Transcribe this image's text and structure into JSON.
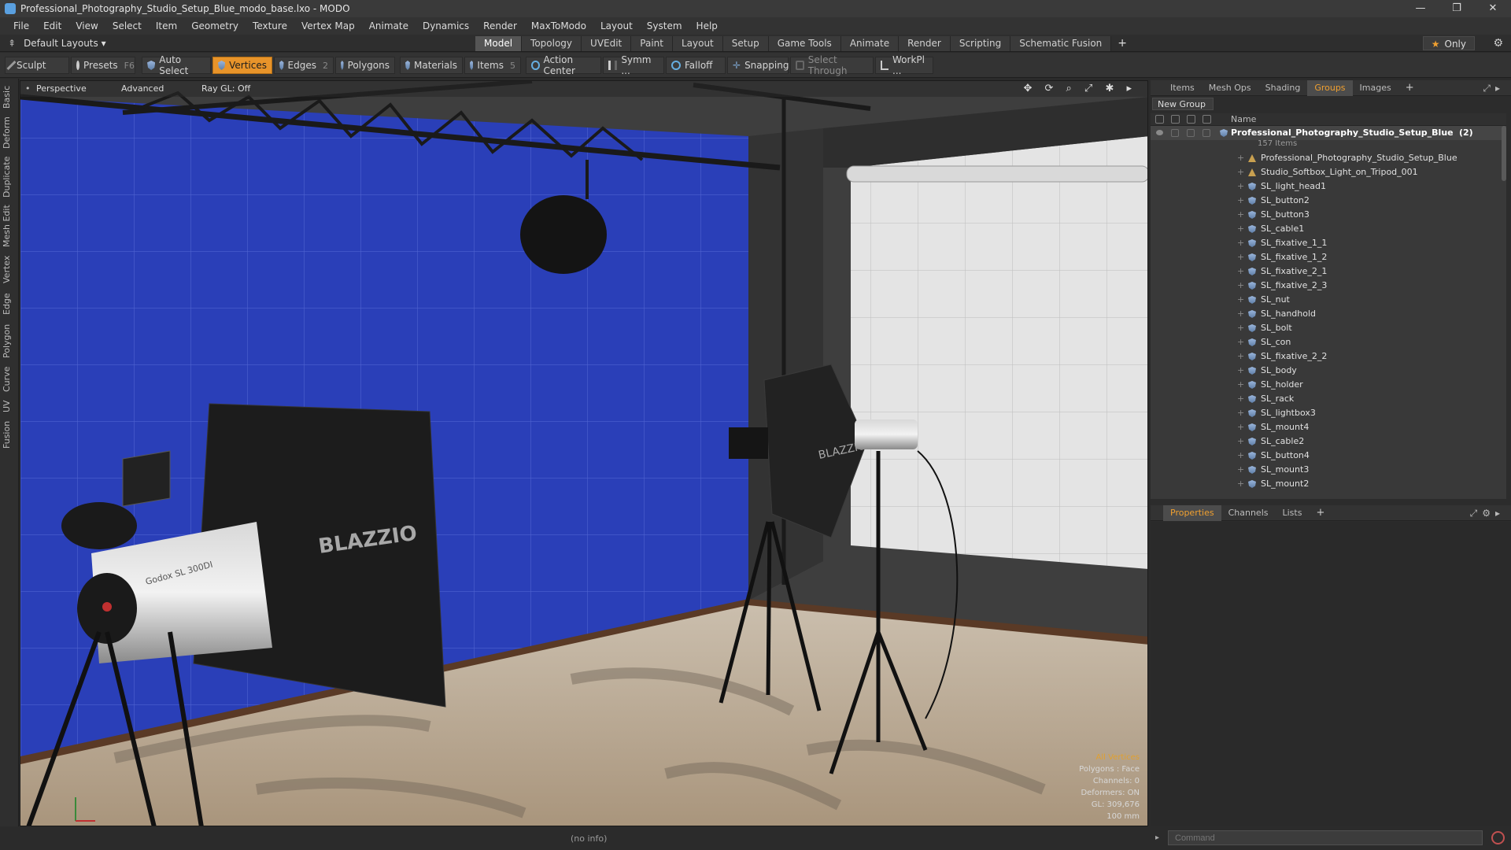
{
  "window": {
    "title": "Professional_Photography_Studio_Setup_Blue_modo_base.lxo - MODO",
    "controls": [
      "—",
      "❐",
      "✕"
    ]
  },
  "menu": [
    "File",
    "Edit",
    "View",
    "Select",
    "Item",
    "Geometry",
    "Texture",
    "Vertex Map",
    "Animate",
    "Dynamics",
    "Render",
    "MaxToModo",
    "Layout",
    "System",
    "Help"
  ],
  "layoutbar": {
    "layout_dropdown": "Default Layouts ▾",
    "tabs": [
      "Model",
      "Topology",
      "UVEdit",
      "Paint",
      "Layout",
      "Setup",
      "Game Tools",
      "Animate",
      "Render",
      "Scripting",
      "Schematic Fusion"
    ],
    "active_tab": "Model",
    "add_tab": "+",
    "only_label": "Only"
  },
  "toolbar": {
    "sculpt": "Sculpt",
    "presets": "Presets",
    "presets_key": "F6",
    "auto_select": "Auto Select",
    "vertices": "Vertices",
    "edges": "Edges",
    "edges_count": "2",
    "polygons": "Polygons",
    "materials": "Materials",
    "items": "Items",
    "items_count": "5",
    "action_center": "Action Center",
    "symm": "Symm ...",
    "falloff": "Falloff",
    "snapping": "Snapping",
    "select_through": "Select Through",
    "workpl": "WorkPl ..."
  },
  "left_strip": [
    "Basic",
    "Deform",
    "Duplicate",
    "Mesh Edit",
    "Vertex",
    "Edge",
    "Polygon",
    "Curve",
    "UV",
    "Fusion"
  ],
  "viewport": {
    "view_mode": "Perspective",
    "shading": "Advanced",
    "raygl": "Ray GL: Off",
    "controls": "✥ ⟳ ⌕ ⤢ ✱ ▸",
    "softbox_logo": "BLAZZIO",
    "flash_logo": "Godox SL 300DI",
    "stats": {
      "mode": "All Vertices",
      "polygons": "Polygons : Face",
      "channels": "Channels: 0",
      "deformers": "Deformers: ON",
      "gl": "GL: 309,676",
      "scale": "100 mm"
    }
  },
  "right_panel": {
    "top_tabs": [
      "Items",
      "Mesh Ops",
      "Shading",
      "Groups",
      "Images"
    ],
    "active_top_tab": "Groups",
    "new_group": "New Group",
    "name_column": "Name",
    "root": {
      "name": "Professional_Photography_Studio_Setup_Blue",
      "count": "(2)",
      "sub": "157 Items"
    },
    "items": [
      {
        "name": "Professional_Photography_Studio_Setup_Blue",
        "kind": "locator"
      },
      {
        "name": "Studio_Softbox_Light_on_Tripod_001",
        "kind": "locator"
      },
      {
        "name": "SL_light_head1",
        "kind": "mesh"
      },
      {
        "name": "SL_button2",
        "kind": "mesh"
      },
      {
        "name": "SL_button3",
        "kind": "mesh"
      },
      {
        "name": "SL_cable1",
        "kind": "mesh"
      },
      {
        "name": "SL_fixative_1_1",
        "kind": "mesh"
      },
      {
        "name": "SL_fixative_1_2",
        "kind": "mesh"
      },
      {
        "name": "SL_fixative_2_1",
        "kind": "mesh"
      },
      {
        "name": "SL_fixative_2_3",
        "kind": "mesh"
      },
      {
        "name": "SL_nut",
        "kind": "mesh"
      },
      {
        "name": "SL_handhold",
        "kind": "mesh"
      },
      {
        "name": "SL_bolt",
        "kind": "mesh"
      },
      {
        "name": "SL_con",
        "kind": "mesh"
      },
      {
        "name": "SL_fixative_2_2",
        "kind": "mesh"
      },
      {
        "name": "SL_body",
        "kind": "mesh"
      },
      {
        "name": "SL_holder",
        "kind": "mesh"
      },
      {
        "name": "SL_rack",
        "kind": "mesh"
      },
      {
        "name": "SL_lightbox3",
        "kind": "mesh"
      },
      {
        "name": "SL_mount4",
        "kind": "mesh"
      },
      {
        "name": "SL_cable2",
        "kind": "mesh"
      },
      {
        "name": "SL_button4",
        "kind": "mesh"
      },
      {
        "name": "SL_mount3",
        "kind": "mesh"
      },
      {
        "name": "SL_mount2",
        "kind": "mesh"
      }
    ],
    "bottom_tabs": [
      "Properties",
      "Channels",
      "Lists"
    ],
    "active_bottom_tab": "Properties"
  },
  "status": {
    "info": "(no info)",
    "command_placeholder": "Command"
  },
  "colors": {
    "accent": "#e8942a",
    "backdrop_blue": "#2a3fb8",
    "panel": "#2c2c2c"
  }
}
